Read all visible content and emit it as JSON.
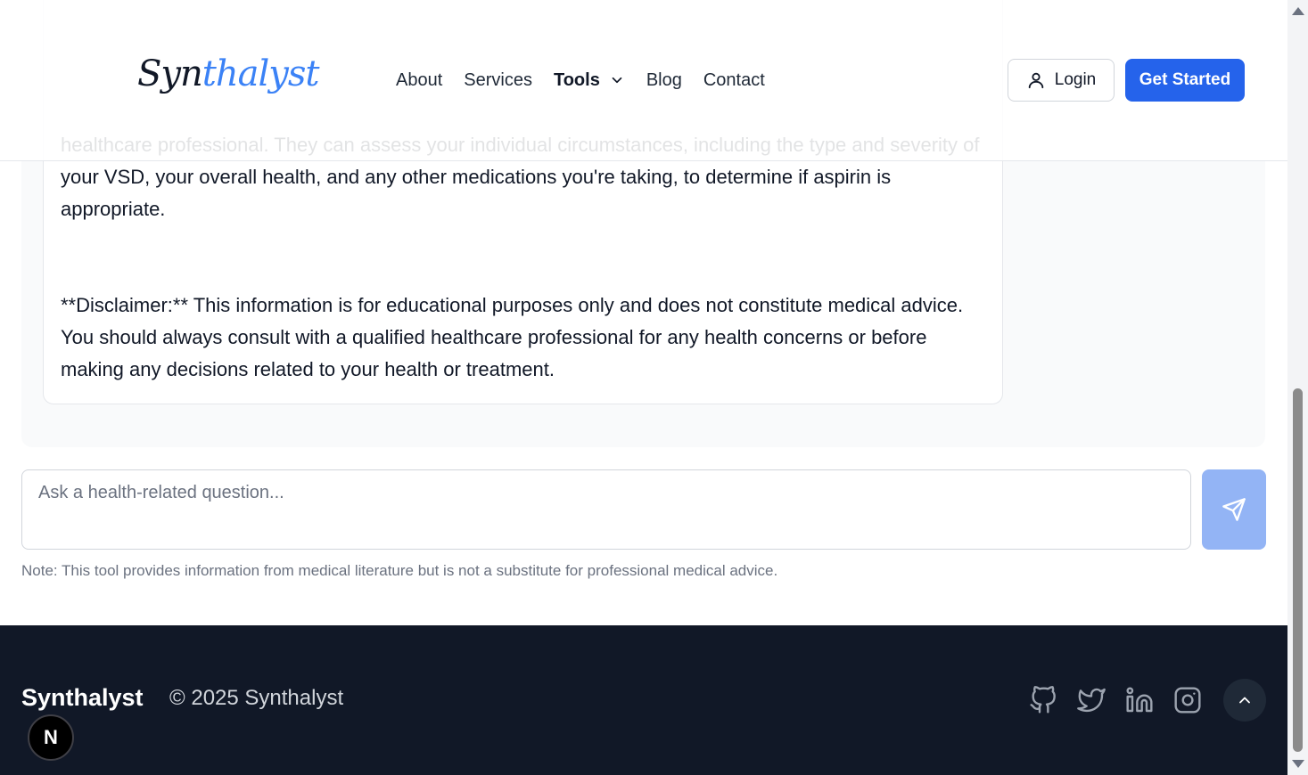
{
  "header": {
    "logo_text_a": "Syn",
    "logo_text_b": "thalyst",
    "nav": [
      "About",
      "Services",
      "Tools",
      "Blog",
      "Contact"
    ],
    "active_nav": "Tools",
    "login_label": "Login",
    "cta_label": "Get Started"
  },
  "chat": {
    "answer_partial_line": "healthcare professional. They can assess your individual circumstances, including the type and severity of your VSD, your overall health, and any other medications you're taking, to determine if aspirin is appropriate.",
    "disclaimer": "**Disclaimer:** This information is for educational purposes only and does not constitute medical advice.  You should always consult with a qualified healthcare professional for any health concerns or before making any decisions related to your health or treatment."
  },
  "input": {
    "placeholder": "Ask a health-related question...",
    "value": "",
    "note": "Note: This tool provides information from medical literature but is not a substitute for professional medical advice."
  },
  "footer": {
    "brand": "Synthalyst",
    "copyright": "© 2025 Synthalyst",
    "social_icons": [
      "github-icon",
      "twitter-icon",
      "linkedin-icon",
      "instagram-icon"
    ]
  },
  "dev_badge": {
    "letter": "N"
  },
  "colors": {
    "primary": "#2563eb",
    "send_disabled": "#93b4f5",
    "footer_bg": "#111827",
    "logo_accent": "#3b82f6"
  }
}
